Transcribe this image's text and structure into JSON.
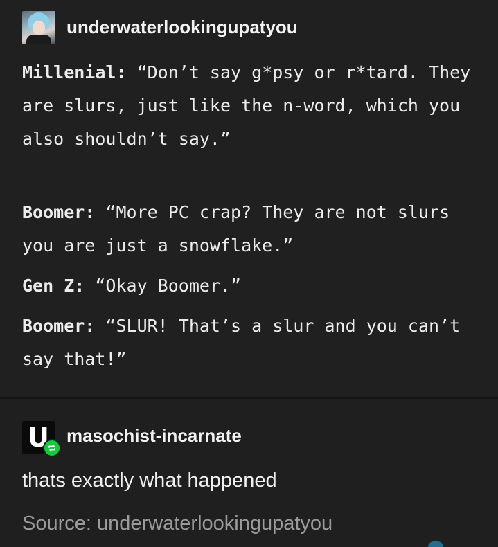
{
  "original_post": {
    "username": "underwaterlookingupatyou",
    "lines": [
      {
        "speaker": "Millenial:",
        "quote": "“Don’t say g*psy or r*tard. They are slurs, just like the n-word, which you also shouldn’t say.”"
      },
      {
        "speaker": "Boomer:",
        "quote": "“More PC crap? They are not slurs you are just a snowflake.”"
      },
      {
        "speaker": "Gen Z:",
        "quote": "“Okay Boomer.”"
      },
      {
        "speaker": "Boomer:",
        "quote": "“SLUR! That’s a slur and you can’t say that!”"
      }
    ]
  },
  "reblog": {
    "username": "masochist-incarnate",
    "avatar_glyph": "U",
    "text": "thats exactly what happened"
  },
  "source": {
    "text": "Source: underwaterlookingupatyou"
  },
  "colors": {
    "background": "#1f1f1f",
    "text": "#ececec",
    "muted_text": "#9a9a9a",
    "reblog_badge": "#17c93f"
  },
  "icons": {
    "reblog_badge": "reblog-icon"
  }
}
